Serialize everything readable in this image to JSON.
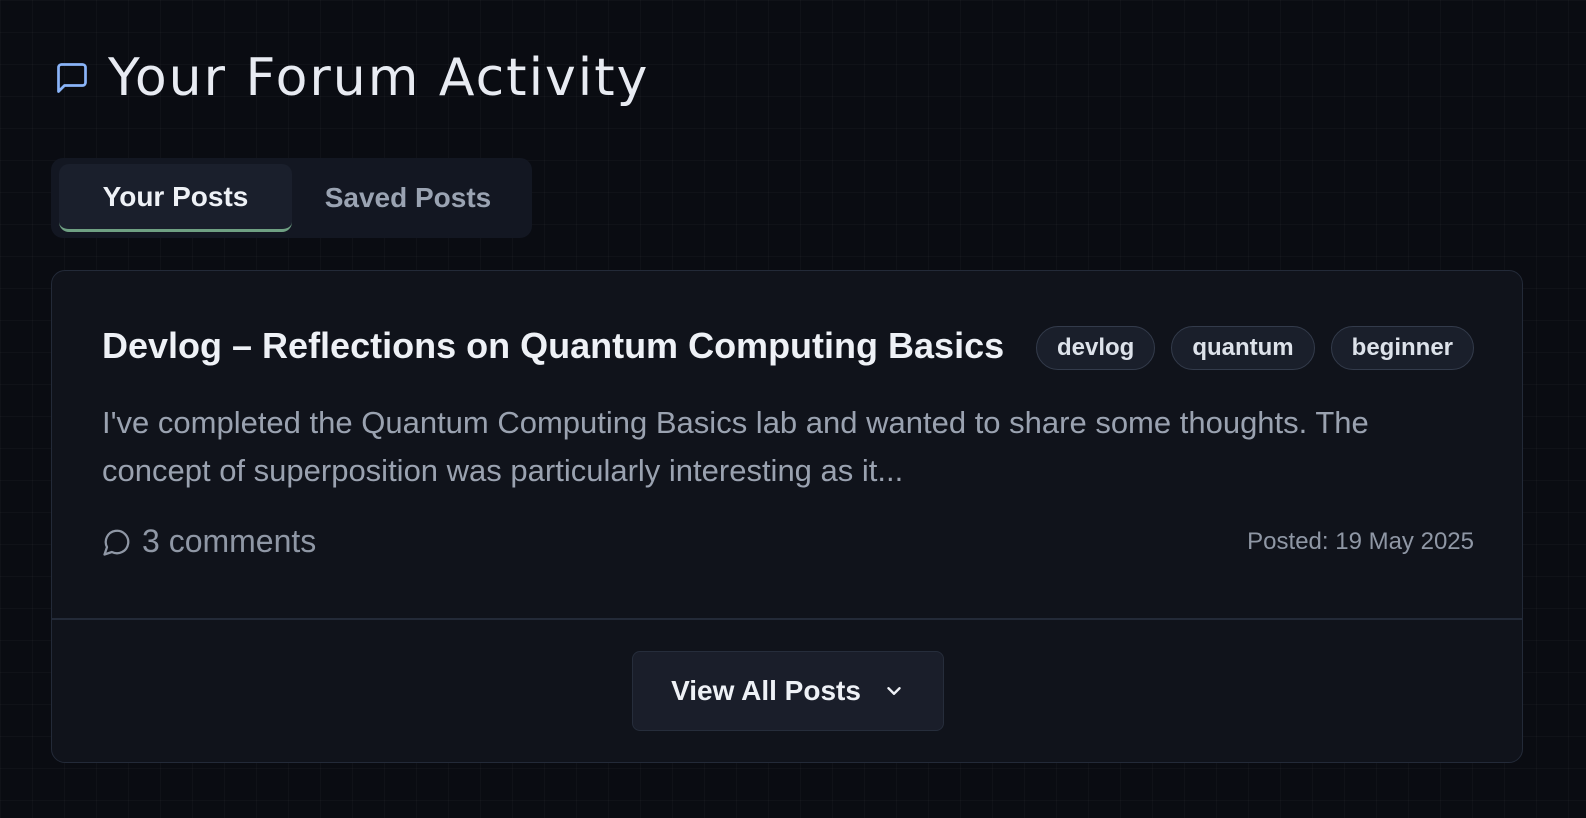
{
  "header": {
    "title": "Your Forum Activity",
    "icon": "message-square-icon"
  },
  "tabs": [
    {
      "label": "Your Posts",
      "active": true
    },
    {
      "label": "Saved Posts",
      "active": false
    }
  ],
  "post": {
    "title": "Devlog – Reflections on Quantum Computing Basics",
    "tags": [
      "devlog",
      "quantum",
      "beginner"
    ],
    "excerpt": "I've completed the Quantum Computing Basics lab and wanted to share some thoughts. The concept of superposition was particularly interesting as it...",
    "comments": "3 comments",
    "posted": "Posted: 19 May 2025"
  },
  "view_all": {
    "label": "View All Posts",
    "icon": "chevron-down-icon"
  },
  "colors": {
    "background": "#0a0c12",
    "card": "#10131b",
    "accent_tab_underline": "#6fa083",
    "icon_blue": "#8ab4f8"
  }
}
